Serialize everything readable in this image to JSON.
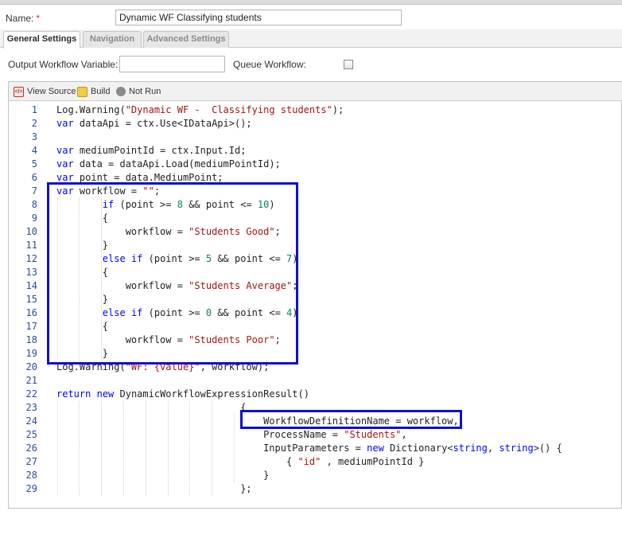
{
  "form": {
    "name_label": "Name:",
    "required_mark": "*",
    "name_value": "Dynamic WF Classifying students"
  },
  "tabs": [
    {
      "label": "General Settings",
      "active": true
    },
    {
      "label": "Navigation",
      "active": false
    },
    {
      "label": "Advanced Settings",
      "active": false
    }
  ],
  "settings": {
    "output_label": "Output Workflow Variable:",
    "output_value": "",
    "queue_label": "Queue Workflow:",
    "queue_checked": false
  },
  "toolbar": {
    "view_source": "View Source",
    "build": "Build",
    "status": "Not Run"
  },
  "code_lines": [
    "Log.Warning(\"Dynamic WF -  Classifying students\");",
    "var dataApi = ctx.Use<IDataApi>();",
    "",
    "var mediumPointId = ctx.Input.Id;",
    "var data = dataApi.Load(mediumPointId);",
    "var point = data.MediumPoint;",
    "var workflow = \"\";",
    "        if (point >= 8 && point <= 10)",
    "        {",
    "            workflow = \"Students Good\";",
    "        }",
    "        else if (point >= 5 && point <= 7)",
    "        {",
    "            workflow = \"Students Average\";",
    "        }",
    "        else if (point >= 0 && point <= 4)",
    "        {",
    "            workflow = \"Students Poor\";",
    "        }",
    "Log.Warning(\"WF: {value}\", workflow);",
    "",
    "return new DynamicWorkflowExpressionResult()",
    "                                {",
    "                                    WorkflowDefinitionName = workflow,",
    "                                    ProcessName = \"Students\",",
    "                                    InputParameters = new Dictionary<string, string>() {",
    "                                        { \"id\" , mediumPointId }",
    "                                    }",
    "                                };"
  ]
}
